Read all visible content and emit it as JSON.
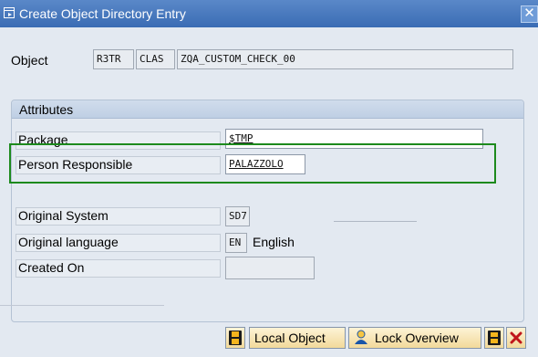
{
  "window": {
    "title": "Create Object Directory Entry",
    "close_label": "✕"
  },
  "object": {
    "label": "Object",
    "pgmid": "R3TR",
    "type": "CLAS",
    "name": "ZQA_CUSTOM_CHECK_00"
  },
  "attributes": {
    "header": "Attributes",
    "package_label": "Package",
    "package_value": "$TMP",
    "person_label": "Person Responsible",
    "person_value": "PALAZZOLO",
    "orig_system_label": "Original System",
    "orig_system_value": "SD7",
    "orig_lang_label": "Original language",
    "orig_lang_code": "EN",
    "orig_lang_name": "English",
    "created_on_label": "Created On",
    "created_on_value": ""
  },
  "toolbar": {
    "local_object_label": "Local Object",
    "lock_overview_label": "Lock Overview"
  },
  "colors": {
    "highlight": "#1d8a1d",
    "title_bar": "#3a6cb4"
  }
}
